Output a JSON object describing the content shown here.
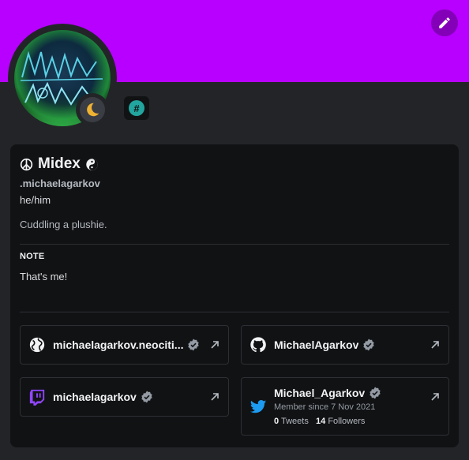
{
  "colors": {
    "banner": "#b700ff",
    "background": "#232428",
    "card": "#111214",
    "badge_accent": "#23a59f",
    "twitch": "#9146ff",
    "twitter": "#1d9bf0"
  },
  "header": {
    "edit_icon": "pencil-icon",
    "avatar_alt": "avatar",
    "status_icon": "moon-icon",
    "badge_icon": "hashtag-badge-icon"
  },
  "profile": {
    "display_name": "Midex",
    "name_prefix_icon": "peace-icon",
    "name_suffix_icon": "yin-yang-icon",
    "username": ".michaelagarkov",
    "pronouns": "he/him",
    "bio": "Cuddling a plushie."
  },
  "note": {
    "label": "NOTE",
    "text": "That's me!"
  },
  "connections": [
    {
      "icon": "globe-icon",
      "name": "michaelagarkov.neociti...",
      "verified": true
    },
    {
      "icon": "github-icon",
      "name": "MichaelAgarkov",
      "verified": true
    },
    {
      "icon": "twitch-icon",
      "name": "michaelagarkov",
      "verified": true
    }
  ],
  "twitter": {
    "icon": "twitter-icon",
    "name": "Michael_Agarkov",
    "verified": true,
    "member_since": "Member since 7 Nov 2021",
    "tweets_count": "0",
    "tweets_label": "Tweets",
    "followers_count": "14",
    "followers_label": "Followers"
  }
}
